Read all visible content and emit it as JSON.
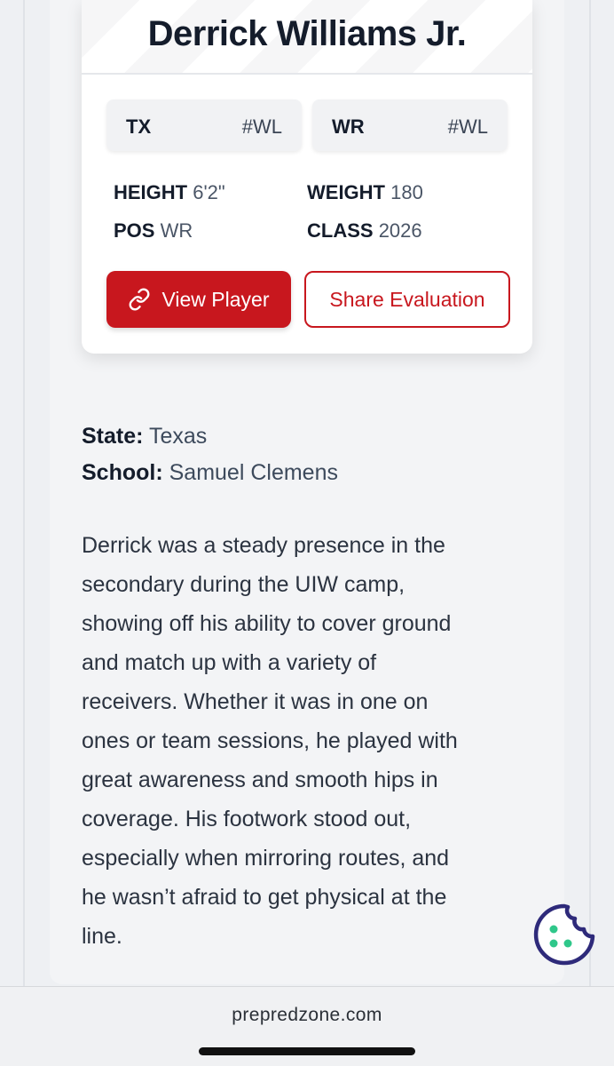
{
  "card": {
    "player_name": "Derrick Williams Jr.",
    "tags": [
      {
        "key": "TX",
        "value": "#WL"
      },
      {
        "key": "WR",
        "value": "#WL"
      }
    ],
    "stats": {
      "height": {
        "label": "HEIGHT",
        "value": "6'2\""
      },
      "weight": {
        "label": "WEIGHT",
        "value": "180"
      },
      "pos": {
        "label": "POS",
        "value": "WR"
      },
      "class": {
        "label": "CLASS",
        "value": "2026"
      }
    },
    "view_button": {
      "label": "View Player",
      "icon": "link-icon"
    },
    "share_button": {
      "label": "Share Evaluation"
    }
  },
  "meta": {
    "state_label": "State:",
    "state_value": "Texas",
    "school_label": "School:",
    "school_value": "Samuel Clemens"
  },
  "evaluation": {
    "lines": [
      "Derrick was a steady presence in the",
      "secondary during the UIW camp,",
      "showing off his ability to cover ground",
      "and match up with a variety of",
      "receivers. Whether it was in one on",
      "ones or team sessions, he played with",
      "great awareness and smooth hips in",
      "coverage. His footwork stood out,",
      "especially when mirroring routes, and",
      "he wasn’t afraid to get physical at the",
      "line."
    ]
  },
  "cookie_button": {
    "icon": "cookie-icon"
  },
  "footer": {
    "url": "prepredzone.com"
  },
  "colors": {
    "accent": "#c8171e",
    "cookie_outline": "#2e2a7a",
    "cookie_dots": "#2fc78a"
  }
}
